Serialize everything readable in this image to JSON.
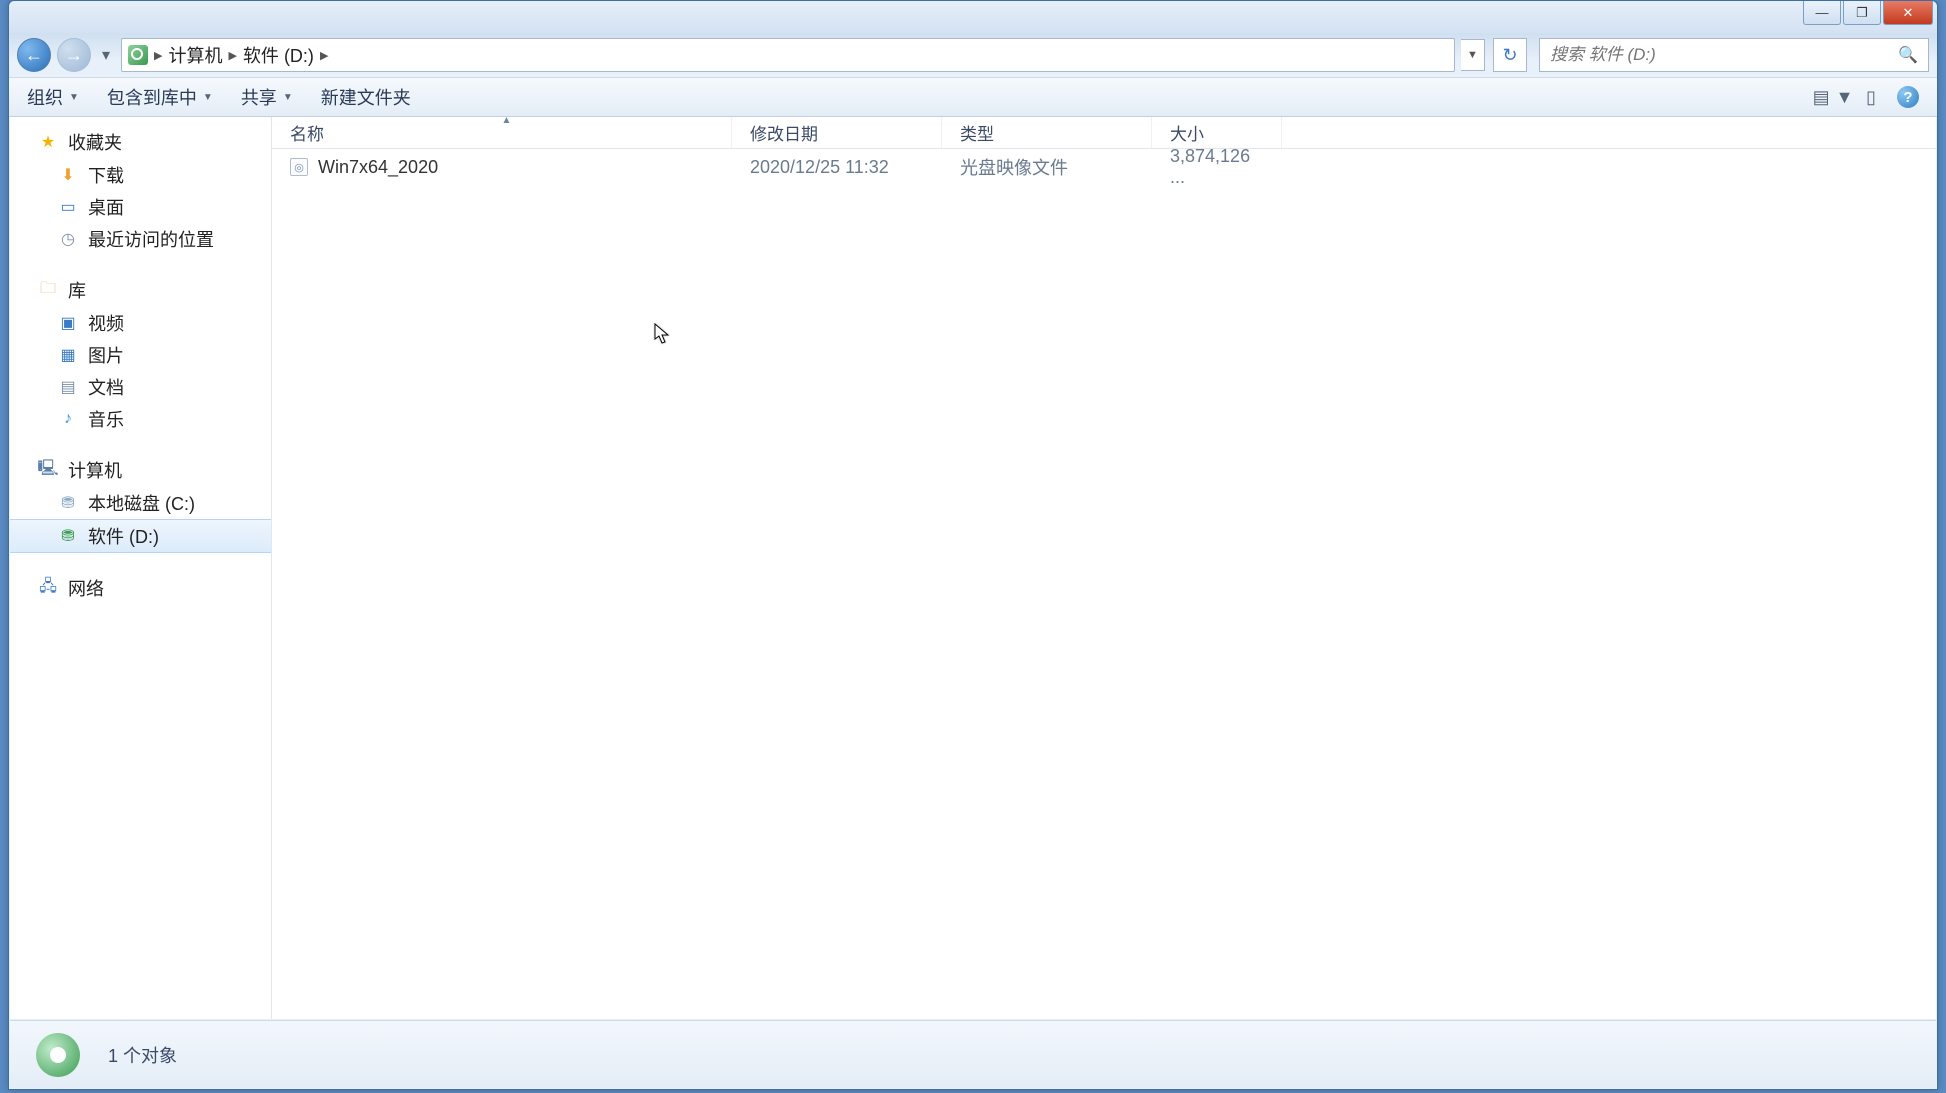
{
  "titlebar": {
    "min": "—",
    "max": "❐",
    "close": "✕"
  },
  "nav": {
    "back": "←",
    "fwd": "→"
  },
  "address": {
    "segments": [
      "计算机",
      "软件 (D:)"
    ],
    "history_glyph": "▼",
    "refresh_glyph": "↻"
  },
  "search": {
    "placeholder": "搜索 软件 (D:)",
    "icon": "🔍"
  },
  "toolbar": {
    "organize": "组织",
    "include": "包含到库中",
    "share": "共享",
    "newfolder": "新建文件夹",
    "view_glyph": "▤",
    "preview_glyph": "▯",
    "help_glyph": "?"
  },
  "sidebar": {
    "favorites": {
      "label": "收藏夹",
      "items": [
        "下载",
        "桌面",
        "最近访问的位置"
      ]
    },
    "libraries": {
      "label": "库",
      "items": [
        "视频",
        "图片",
        "文档",
        "音乐"
      ]
    },
    "computer": {
      "label": "计算机",
      "items": [
        "本地磁盘 (C:)",
        "软件 (D:)"
      ],
      "selected": 1
    },
    "network": {
      "label": "网络"
    }
  },
  "columns": {
    "name": "名称",
    "date": "修改日期",
    "type": "类型",
    "size": "大小"
  },
  "files": [
    {
      "name": "Win7x64_2020",
      "date": "2020/12/25 11:32",
      "type": "光盘映像文件",
      "size": "3,874,126 ..."
    }
  ],
  "status": {
    "count": "1 个对象"
  }
}
